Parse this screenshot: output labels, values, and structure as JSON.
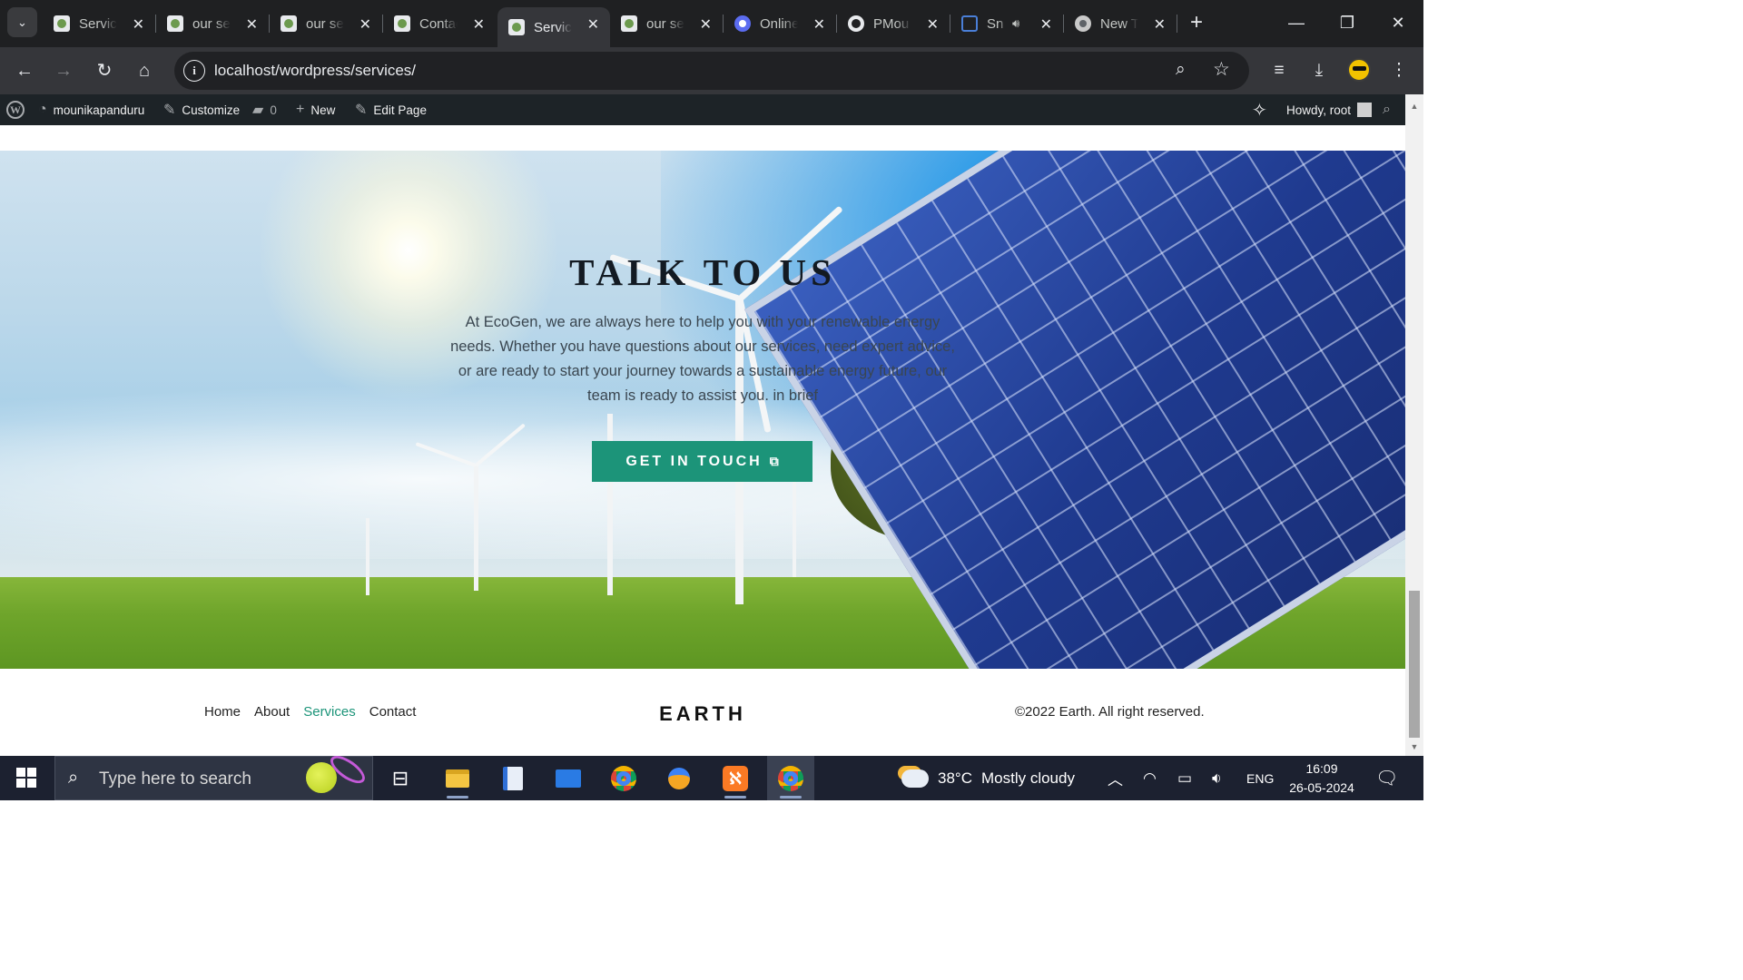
{
  "browser": {
    "tabs": [
      {
        "label": "Services",
        "favicon": "site-favicon",
        "active": false
      },
      {
        "label": "our services",
        "favicon": "site-favicon",
        "active": false
      },
      {
        "label": "our services",
        "favicon": "site-favicon",
        "active": false
      },
      {
        "label": "Contact",
        "favicon": "site-favicon",
        "active": false
      },
      {
        "label": "Services",
        "favicon": "site-favicon",
        "active": true
      },
      {
        "label": "our services",
        "favicon": "site-favicon",
        "active": false
      },
      {
        "label": "Online",
        "favicon": "purple-circle-favicon",
        "active": false
      },
      {
        "label": "PMou",
        "favicon": "github-favicon",
        "active": false
      },
      {
        "label": "Sn",
        "favicon": "snip-favicon",
        "active": false,
        "audio": true
      },
      {
        "label": "New Tab",
        "favicon": "chrome-favicon",
        "active": false
      }
    ],
    "url": "localhost/wordpress/services/"
  },
  "adminbar": {
    "site_name": "mounikapanduru",
    "customize": "Customize",
    "comments_count": "0",
    "new": "New",
    "edit_page": "Edit Page",
    "howdy": "Howdy, root"
  },
  "hero": {
    "title": "TALK TO US",
    "text": "At EcoGen, we are always here to help you with your renewable energy needs. Whether you have questions about our services, need expert advice, or are ready to start your journey towards a sustainable energy future, our team is ready to assist you. in brief",
    "cta": "GET IN TOUCH"
  },
  "footer": {
    "nav": [
      "Home",
      "About",
      "Services",
      "Contact"
    ],
    "current": "Services",
    "logo": "EARTH",
    "copyright": "©2022 Earth. All right reserved."
  },
  "taskbar": {
    "search_placeholder": "Type here to search",
    "weather_temp": "38°C",
    "weather_desc": "Mostly cloudy",
    "language": "ENG",
    "time": "16:09",
    "date": "26-05-2024"
  },
  "colors": {
    "accent": "#1c9479",
    "adminbar": "#1d2327",
    "chrome_dark": "#35363a",
    "taskbar": "#1c2130"
  }
}
